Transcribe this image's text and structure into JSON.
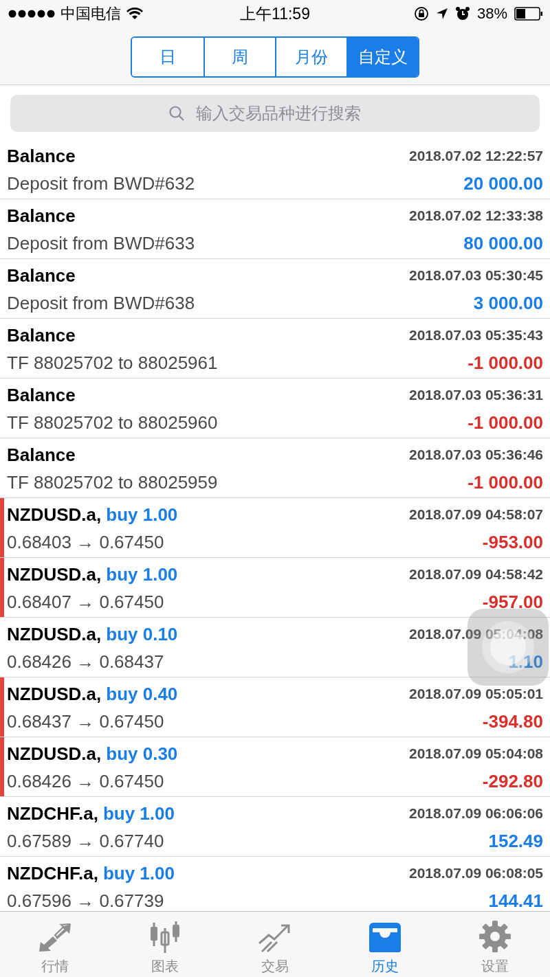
{
  "status_bar": {
    "carrier": "中国电信",
    "time": "上午11:59",
    "battery": "38%"
  },
  "segments": [
    {
      "label": "日",
      "selected": false
    },
    {
      "label": "周",
      "selected": false
    },
    {
      "label": "月份",
      "selected": false
    },
    {
      "label": "自定义",
      "selected": true
    }
  ],
  "search": {
    "placeholder": "输入交易品种进行搜索"
  },
  "rows": [
    {
      "kind": "balance",
      "title": "Balance",
      "time": "2018.07.02 12:22:57",
      "detail": "Deposit from BWD#632",
      "amount": "20 000.00",
      "negative": false
    },
    {
      "kind": "balance",
      "title": "Balance",
      "time": "2018.07.02 12:33:38",
      "detail": "Deposit from BWD#633",
      "amount": "80 000.00",
      "negative": false
    },
    {
      "kind": "balance",
      "title": "Balance",
      "time": "2018.07.03 05:30:45",
      "detail": "Deposit from BWD#638",
      "amount": "3 000.00",
      "negative": false
    },
    {
      "kind": "balance",
      "title": "Balance",
      "time": "2018.07.03 05:35:43",
      "detail": "TF 88025702 to 88025961",
      "amount": "-1 000.00",
      "negative": true
    },
    {
      "kind": "balance",
      "title": "Balance",
      "time": "2018.07.03 05:36:31",
      "detail": "TF 88025702 to 88025960",
      "amount": "-1 000.00",
      "negative": true
    },
    {
      "kind": "balance",
      "title": "Balance",
      "time": "2018.07.03 05:36:46",
      "detail": "TF 88025702 to 88025959",
      "amount": "-1 000.00",
      "negative": true
    },
    {
      "kind": "trade",
      "title": "NZDUSD.a,",
      "order": "buy 1.00",
      "time": "2018.07.09 04:58:07",
      "detail": "0.68403 → 0.67450",
      "amount": "-953.00",
      "negative": true
    },
    {
      "kind": "trade",
      "title": "NZDUSD.a,",
      "order": "buy 1.00",
      "time": "2018.07.09 04:58:42",
      "detail": "0.68407 → 0.67450",
      "amount": "-957.00",
      "negative": true
    },
    {
      "kind": "trade",
      "title": "NZDUSD.a,",
      "order": "buy 0.10",
      "time": "2018.07.09 05:04:08",
      "detail": "0.68426 → 0.68437",
      "amount": "1.10",
      "negative": false
    },
    {
      "kind": "trade",
      "title": "NZDUSD.a,",
      "order": "buy 0.40",
      "time": "2018.07.09 05:05:01",
      "detail": "0.68437 → 0.67450",
      "amount": "-394.80",
      "negative": true
    },
    {
      "kind": "trade",
      "title": "NZDUSD.a,",
      "order": "buy 0.30",
      "time": "2018.07.09 05:04:08",
      "detail": "0.68426 → 0.67450",
      "amount": "-292.80",
      "negative": true
    },
    {
      "kind": "trade",
      "title": "NZDCHF.a,",
      "order": "buy 1.00",
      "time": "2018.07.09 06:06:06",
      "detail": "0.67589 → 0.67740",
      "amount": "152.49",
      "negative": false
    },
    {
      "kind": "trade",
      "title": "NZDCHF.a,",
      "order": "buy 1.00",
      "time": "2018.07.09 06:08:05",
      "detail": "0.67596 → 0.67739",
      "amount": "144.41",
      "negative": false
    }
  ],
  "tab_bar": [
    {
      "label": "行情",
      "kind": "arrows",
      "selected": false
    },
    {
      "label": "图表",
      "kind": "candles",
      "selected": false
    },
    {
      "label": "交易",
      "kind": "trend",
      "selected": false
    },
    {
      "label": "历史",
      "kind": "inbox",
      "selected": true
    },
    {
      "label": "设置",
      "kind": "gear",
      "selected": false
    }
  ]
}
